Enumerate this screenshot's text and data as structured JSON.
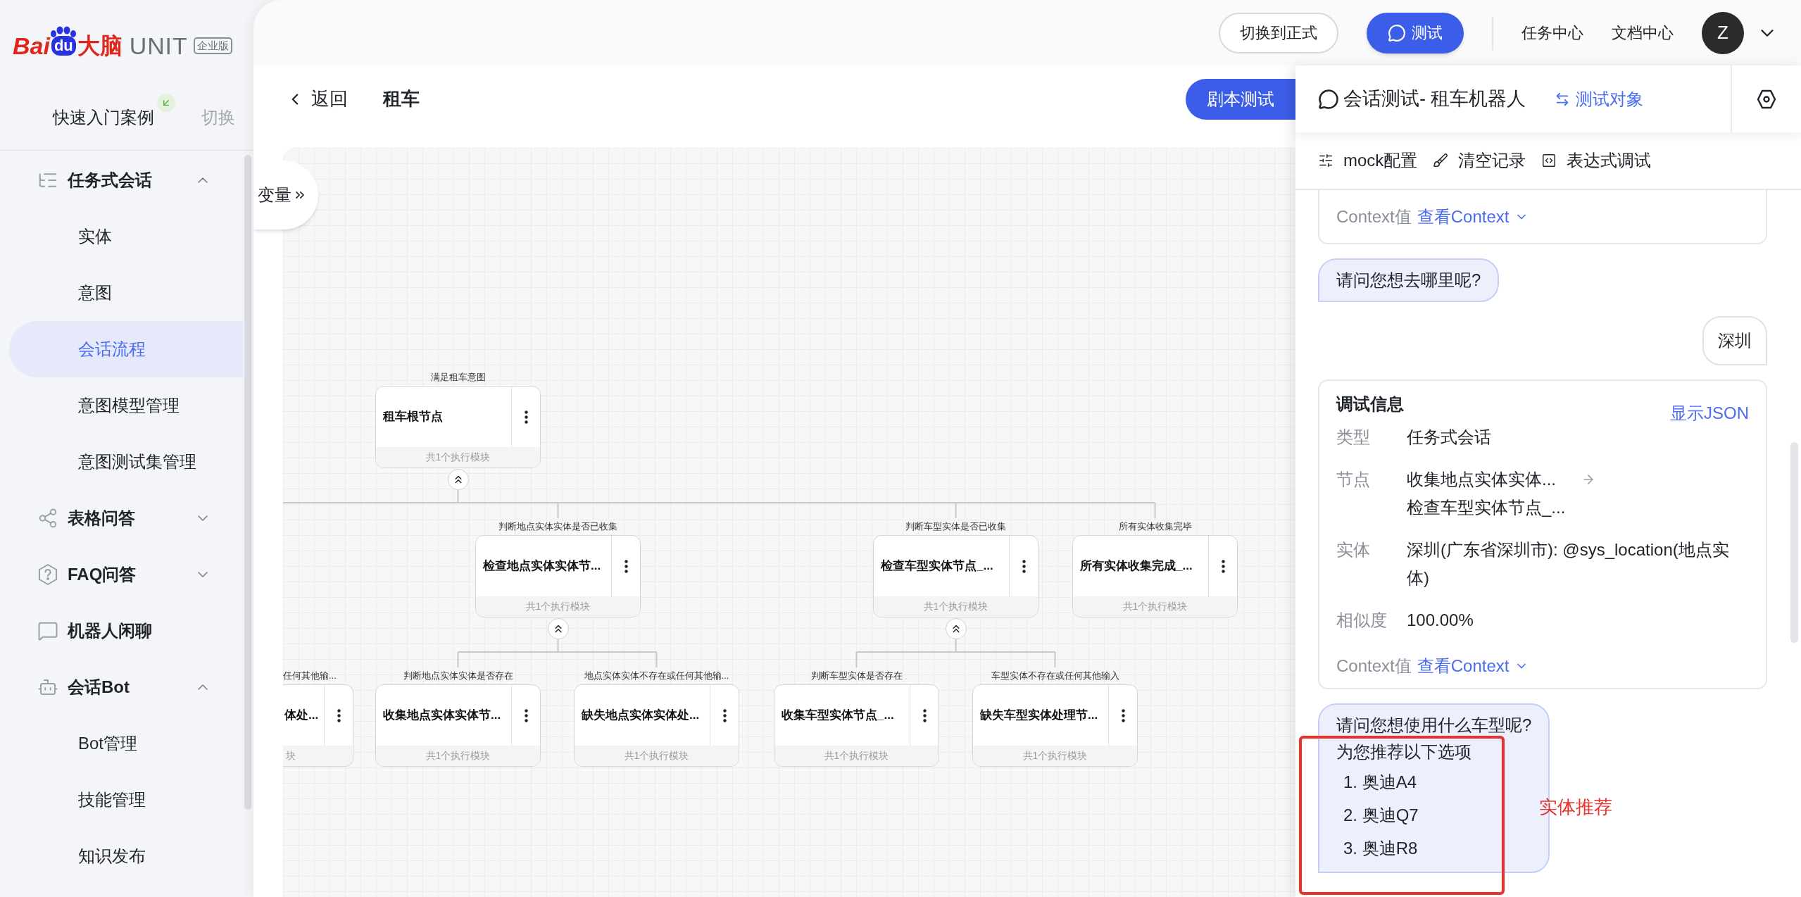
{
  "logo": {
    "parts": [
      "Bai",
      "du",
      "大脑",
      "UNIT"
    ],
    "badge": "企业版"
  },
  "project": {
    "name": "快速入门案例",
    "switch": "切换"
  },
  "sidebar": {
    "items": [
      {
        "kind": "group",
        "label": "任务式会话",
        "expanded": true,
        "children": [
          {
            "label": "实体",
            "selected": false
          },
          {
            "label": "意图",
            "selected": false
          },
          {
            "label": "会话流程",
            "selected": true
          },
          {
            "label": "意图模型管理",
            "selected": false
          },
          {
            "label": "意图测试集管理",
            "selected": false
          }
        ]
      },
      {
        "kind": "group",
        "label": "表格问答",
        "expanded": false
      },
      {
        "kind": "group",
        "label": "FAQ问答",
        "expanded": false
      },
      {
        "kind": "link",
        "label": "机器人闲聊"
      },
      {
        "kind": "group",
        "label": "会话Bot",
        "expanded": true,
        "children": [
          {
            "label": "Bot管理",
            "selected": false
          },
          {
            "label": "技能管理",
            "selected": false
          },
          {
            "label": "知识发布",
            "selected": false
          }
        ]
      }
    ]
  },
  "header": {
    "buttons": [
      {
        "label": "切换到正式",
        "kind": "outline"
      },
      {
        "label": "测试",
        "kind": "primary"
      }
    ],
    "links": [
      "任务中心",
      "文档中心"
    ],
    "user": {
      "initial": "Z"
    }
  },
  "page": {
    "back": "返回",
    "title": "租车",
    "action": "剧本测试"
  },
  "canvas": {
    "side_tab": "变量",
    "tree": {
      "label": "满足租车意图",
      "title": "租车根节点",
      "footer": "共1个执行模块",
      "expanded": true,
      "children": [
        {
          "label": "判断地点实体实体是否已收集",
          "title": "检查地点实体实体节...",
          "footer": "共1个执行模块",
          "expanded": true,
          "children": [
            {
              "label": "判断地点实体实体是否存在",
              "title": "收集地点实体实体节...",
              "footer": "共1个执行模块"
            },
            {
              "label": "地点实体实体不存在或任何其他输...",
              "title": "缺失地点实体实体处...",
              "footer": "共1个执行模块"
            }
          ]
        },
        {
          "label": "判断车型实体是否已收集",
          "title": "检查车型实体节点_...",
          "footer": "共1个执行模块",
          "expanded": true,
          "children": [
            {
              "label": "判断车型实体是否存在",
              "title": "收集车型实体节点_...",
              "footer": "共1个执行模块"
            },
            {
              "label": "车型实体不存在或任何其他输入",
              "title": "缺失车型实体处理节...",
              "footer": "共1个执行模块"
            }
          ]
        },
        {
          "label": "所有实体收集完毕",
          "title": "所有实体收集完成_...",
          "footer": "共1个执行模块"
        }
      ]
    },
    "partial_node": {
      "label": "任何其他输...",
      "title": "体处...",
      "footer": "块"
    }
  },
  "chat_panel": {
    "title": "会话测试- 租车机器人",
    "target_link": "测试对象",
    "tools": [
      "mock配置",
      "清空记录",
      "表达式调试"
    ],
    "messages": [
      {
        "kind": "context",
        "label": "Context值",
        "link": "查看Context"
      },
      {
        "kind": "bot",
        "lines": [
          "请问您想去哪里呢?"
        ]
      },
      {
        "kind": "user",
        "lines": [
          "深圳"
        ]
      },
      {
        "kind": "debug",
        "title": "调试信息",
        "json_link": "显示JSON",
        "fields": [
          {
            "kind": "text",
            "label": "类型",
            "values": [
              "任务式会话"
            ]
          },
          {
            "kind": "path",
            "label": "节点",
            "values": [
              "收集地点实体实体...",
              "检查车型实体节点_..."
            ]
          },
          {
            "kind": "text",
            "label": "实体",
            "values": [
              "深圳(广东省深圳市): @sys_location(地点实体)"
            ]
          },
          {
            "kind": "text",
            "label": "相似度",
            "values": [
              "100.00%"
            ]
          }
        ],
        "context_label": "Context值",
        "context_link": "查看Context"
      },
      {
        "kind": "bot",
        "lines": [
          "请问您想使用什么车型呢?",
          "为您推荐以下选项"
        ],
        "options": [
          "1. 奥迪A4",
          "2. 奥迪Q7",
          "3. 奥迪R8"
        ]
      }
    ]
  },
  "annotation": {
    "label": "实体推荐"
  }
}
